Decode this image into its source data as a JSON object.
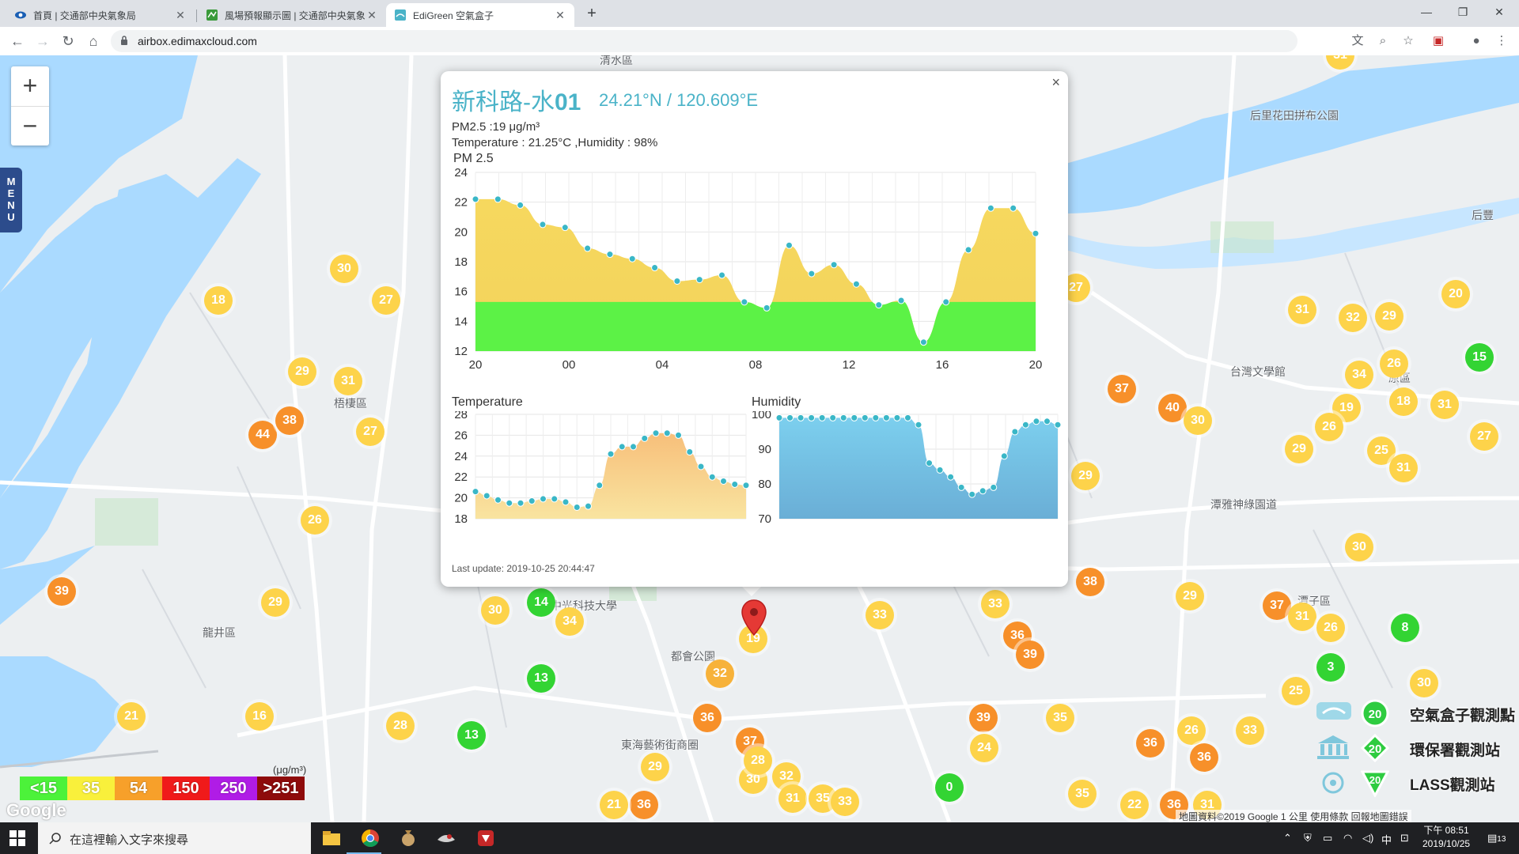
{
  "browser": {
    "tabs": [
      {
        "title": "首頁 | 交通部中央氣象局",
        "active": false
      },
      {
        "title": "風場預報顯示圖 | 交通部中央氣象局",
        "active": false
      },
      {
        "title": "EdiGreen 空氣盒子",
        "active": true
      }
    ],
    "url": "airbox.edimaxcloud.com"
  },
  "map": {
    "zoom_in": "+",
    "zoom_out": "−",
    "menu": [
      "M",
      "E",
      "N",
      "U"
    ],
    "labels": [
      "清水區",
      "梧棲區",
      "龍井區",
      "都會公園",
      "東海藝術街商圈",
      "台灣文學館",
      "潭雅神綠園道",
      "潭子區",
      "后里花田拼布公園",
      "后豐",
      "中光科技大學",
      "原區"
    ],
    "markers": [
      {
        "v": "18",
        "c": "#fdd34a"
      },
      {
        "v": "30",
        "c": "#fdd34a"
      },
      {
        "v": "27",
        "c": "#fdd34a"
      },
      {
        "v": "29",
        "c": "#fdd34a"
      },
      {
        "v": "31",
        "c": "#fdd34a"
      },
      {
        "v": "27",
        "c": "#fdd34a"
      },
      {
        "v": "44",
        "c": "#f7902a"
      },
      {
        "v": "38",
        "c": "#f7902a"
      },
      {
        "v": "26",
        "c": "#fdd34a"
      },
      {
        "v": "39",
        "c": "#f7902a"
      },
      {
        "v": "29",
        "c": "#fdd34a"
      },
      {
        "v": "21",
        "c": "#fdd34a"
      },
      {
        "v": "16",
        "c": "#fdd34a"
      },
      {
        "v": "28",
        "c": "#fdd34a"
      },
      {
        "v": "13",
        "c": "#33d433"
      },
      {
        "v": "13",
        "c": "#33d433"
      },
      {
        "v": "14",
        "c": "#33d433"
      },
      {
        "v": "30",
        "c": "#fdd34a"
      },
      {
        "v": "34",
        "c": "#fdd34a"
      },
      {
        "v": "32",
        "c": "#f7b23a"
      },
      {
        "v": "36",
        "c": "#f7902a"
      },
      {
        "v": "37",
        "c": "#f7902a"
      },
      {
        "v": "29",
        "c": "#fdd34a"
      },
      {
        "v": "36",
        "c": "#f7902a"
      },
      {
        "v": "32",
        "c": "#fdd34a"
      },
      {
        "v": "30",
        "c": "#fdd34a"
      },
      {
        "v": "31",
        "c": "#fdd34a"
      },
      {
        "v": "35",
        "c": "#fdd34a"
      },
      {
        "v": "33",
        "c": "#fdd34a"
      },
      {
        "v": "28",
        "c": "#fdd34a"
      },
      {
        "v": "33",
        "c": "#fdd34a"
      },
      {
        "v": "33",
        "c": "#fdd34a"
      },
      {
        "v": "36",
        "c": "#f7902a"
      },
      {
        "v": "39",
        "c": "#f7902a"
      },
      {
        "v": "39",
        "c": "#f7902a"
      },
      {
        "v": "24",
        "c": "#fdd34a"
      },
      {
        "v": "0",
        "c": "#33d433"
      },
      {
        "v": "38",
        "c": "#f7902a"
      },
      {
        "v": "29",
        "c": "#fdd34a"
      },
      {
        "v": "27",
        "c": "#fdd34a"
      },
      {
        "v": "37",
        "c": "#f7902a"
      },
      {
        "v": "35",
        "c": "#fdd34a"
      },
      {
        "v": "40",
        "c": "#f7902a"
      },
      {
        "v": "30",
        "c": "#fdd34a"
      },
      {
        "v": "31",
        "c": "#fdd34a"
      },
      {
        "v": "32",
        "c": "#fdd34a"
      },
      {
        "v": "29",
        "c": "#fdd34a"
      },
      {
        "v": "20",
        "c": "#fdd34a"
      },
      {
        "v": "15",
        "c": "#33d433"
      },
      {
        "v": "34",
        "c": "#fdd34a"
      },
      {
        "v": "26",
        "c": "#fdd34a"
      },
      {
        "v": "19",
        "c": "#fdd34a"
      },
      {
        "v": "18",
        "c": "#fdd34a"
      },
      {
        "v": "31",
        "c": "#fdd34a"
      },
      {
        "v": "26",
        "c": "#fdd34a"
      },
      {
        "v": "29",
        "c": "#fdd34a"
      },
      {
        "v": "25",
        "c": "#fdd34a"
      },
      {
        "v": "31",
        "c": "#fdd34a"
      },
      {
        "v": "27",
        "c": "#fdd34a"
      },
      {
        "v": "30",
        "c": "#fdd34a"
      },
      {
        "v": "29",
        "c": "#fdd34a"
      },
      {
        "v": "37",
        "c": "#f7902a"
      },
      {
        "v": "31",
        "c": "#fdd34a"
      },
      {
        "v": "26",
        "c": "#fdd34a"
      },
      {
        "v": "3",
        "c": "#33d433"
      },
      {
        "v": "8",
        "c": "#33d433"
      },
      {
        "v": "30",
        "c": "#fdd34a"
      },
      {
        "v": "25",
        "c": "#fdd34a"
      },
      {
        "v": "33",
        "c": "#fdd34a"
      },
      {
        "v": "26",
        "c": "#fdd34a"
      },
      {
        "v": "36",
        "c": "#f7902a"
      },
      {
        "v": "36",
        "c": "#f7902a"
      },
      {
        "v": "22",
        "c": "#fdd34a"
      },
      {
        "v": "35",
        "c": "#fdd34a"
      },
      {
        "v": "31",
        "c": "#fdd34a"
      },
      {
        "v": "36",
        "c": "#f7902a"
      },
      {
        "v": "21",
        "c": "#fdd34a"
      },
      {
        "v": "31",
        "c": "#fdd34a"
      },
      {
        "v": "19",
        "c": "#fdd34a"
      }
    ],
    "aqi_legend": [
      {
        "label": "<15",
        "color": "#4cf23a"
      },
      {
        "label": "35",
        "color": "#f9f03b"
      },
      {
        "label": "54",
        "color": "#f7a02a"
      },
      {
        "label": "150",
        "color": "#f01a1a"
      },
      {
        "label": "250",
        "color": "#b01ce6"
      },
      {
        "label": ">251",
        "color": "#8e0b0b"
      }
    ],
    "aqi_unit": "(μg/m³)",
    "google": "Google",
    "station_legend": [
      {
        "label": "空氣盒子觀測點",
        "badge": "20"
      },
      {
        "label": "環保署觀測站",
        "badge": "20"
      },
      {
        "label": "LASS觀測站",
        "badge": "20"
      }
    ],
    "footer": "地圖資料©2019 Google   1 公里            使用條款   回報地圖錯誤"
  },
  "popup": {
    "title_prefix": "新科路-水",
    "title_num": "01",
    "coords": "24.21°N / 120.609°E",
    "pm_line": "PM2.5 :19 μg/m³",
    "temp_line": "Temperature : 21.25°C ,Humidity : 98%",
    "pm_chart_title": "PM 2.5",
    "temp_chart_title": "Temperature",
    "hum_chart_title": "Humidity",
    "last_update": "Last update: 2019-10-25 20:44:47",
    "close": "×"
  },
  "chart_data": [
    {
      "type": "area",
      "title": "PM 2.5",
      "x_ticks": [
        "20",
        "00",
        "04",
        "08",
        "12",
        "16",
        "20"
      ],
      "ylim": [
        12,
        24
      ],
      "y_ticks": [
        12,
        14,
        16,
        18,
        20,
        22,
        24
      ],
      "threshold": 15.3,
      "values": [
        22.2,
        22.2,
        21.8,
        20.5,
        20.3,
        18.9,
        18.5,
        18.2,
        17.6,
        16.7,
        16.8,
        17.1,
        15.3,
        14.9,
        19.1,
        17.2,
        17.8,
        16.5,
        15.1,
        15.4,
        12.6,
        15.3,
        18.8,
        21.6,
        21.6,
        19.9
      ]
    },
    {
      "type": "area",
      "title": "Temperature",
      "ylim": [
        18,
        28
      ],
      "y_ticks": [
        18,
        20,
        22,
        24,
        26,
        28
      ],
      "values": [
        20.6,
        20.2,
        19.8,
        19.5,
        19.5,
        19.7,
        19.9,
        19.9,
        19.6,
        19.1,
        19.2,
        21.2,
        24.2,
        24.9,
        24.9,
        25.7,
        26.2,
        26.2,
        26.0,
        24.4,
        23.0,
        22.0,
        21.6,
        21.3,
        21.2
      ]
    },
    {
      "type": "area",
      "title": "Humidity",
      "ylim": [
        70,
        100
      ],
      "y_ticks": [
        70,
        80,
        90,
        100
      ],
      "values": [
        99,
        99,
        99,
        99,
        99,
        99,
        99,
        99,
        99,
        99,
        99,
        99,
        99,
        97,
        86,
        84,
        82,
        79,
        77,
        78,
        79,
        88,
        95,
        97,
        98,
        98,
        97
      ]
    }
  ],
  "taskbar": {
    "search_placeholder": "在這裡輸入文字來搜尋",
    "tray": [
      "中"
    ],
    "time": "下午 08:51",
    "date": "2019/10/25",
    "notif": "13"
  }
}
